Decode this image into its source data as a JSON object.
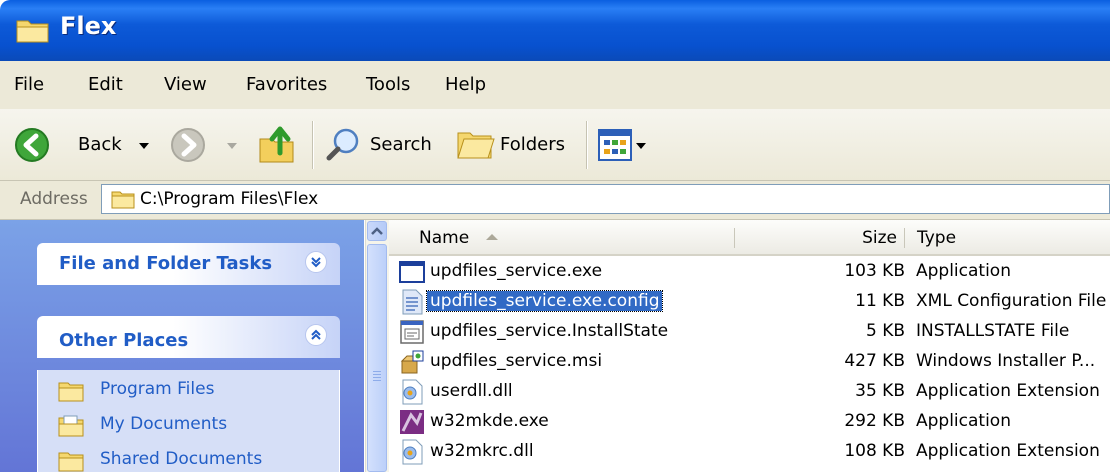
{
  "window": {
    "title": "Flex"
  },
  "menu": [
    "File",
    "Edit",
    "View",
    "Favorites",
    "Tools",
    "Help"
  ],
  "toolbar": {
    "back_label": "Back",
    "search_label": "Search",
    "folders_label": "Folders"
  },
  "address": {
    "label": "Address",
    "path": "C:\\Program Files\\Flex"
  },
  "tasks": {
    "file_folder_title": "File and Folder Tasks",
    "other_places_title": "Other Places",
    "places": [
      "Program Files",
      "My Documents",
      "Shared Documents"
    ]
  },
  "columns": {
    "name": "Name",
    "size": "Size",
    "type": "Type"
  },
  "files": [
    {
      "name": "updfiles_service.exe",
      "size": "103 KB",
      "type": "Application",
      "icon": "application-icon",
      "selected": false
    },
    {
      "name": "updfiles_service.exe.config",
      "size": "11 KB",
      "type": "XML Configuration File",
      "icon": "xml-config-icon",
      "selected": true
    },
    {
      "name": "updfiles_service.InstallState",
      "size": "5 KB",
      "type": "INSTALLSTATE File",
      "icon": "generic-file-icon",
      "selected": false
    },
    {
      "name": "updfiles_service.msi",
      "size": "427 KB",
      "type": "Windows Installer P...",
      "icon": "installer-package-icon",
      "selected": false
    },
    {
      "name": "userdll.dll",
      "size": "35 KB",
      "type": "Application Extension",
      "icon": "dll-icon",
      "selected": false
    },
    {
      "name": "w32mkde.exe",
      "size": "292 KB",
      "type": "Application",
      "icon": "mkde-exe-icon",
      "selected": false
    },
    {
      "name": "w32mkrc.dll",
      "size": "108 KB",
      "type": "Application Extension",
      "icon": "dll-icon",
      "selected": false
    }
  ],
  "colors": {
    "titlebar_blue": "#0a5fe0",
    "selection_blue": "#316ac5",
    "task_link_blue": "#215dc6",
    "taskpane_bg": "#7ba2e7"
  }
}
